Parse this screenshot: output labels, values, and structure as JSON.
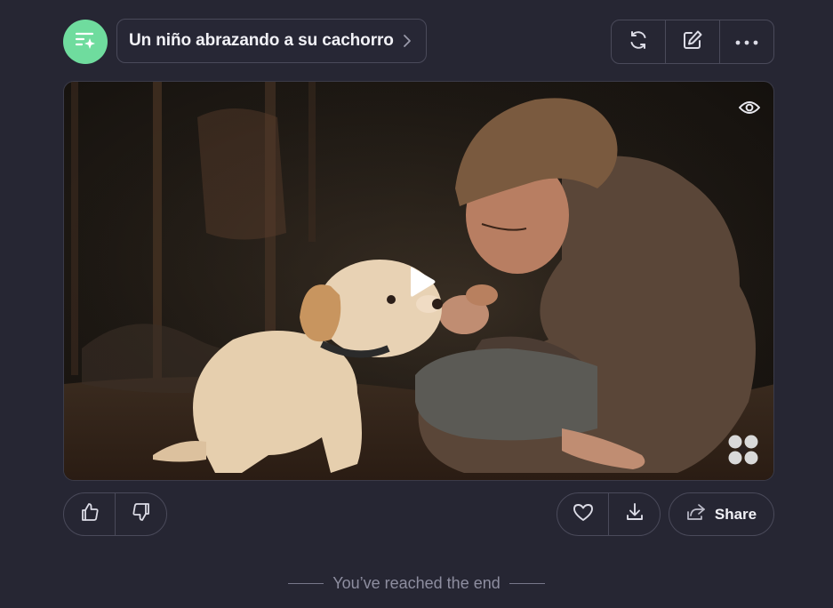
{
  "header": {
    "avatar_icon": "sparkle-list-icon",
    "prompt": "Un niño abrazando a su cachorro",
    "prompt_chevron_icon": "chevron-right-icon",
    "tools": [
      {
        "name": "regenerate-button",
        "icon": "refresh-icon"
      },
      {
        "name": "edit-button",
        "icon": "edit-icon"
      },
      {
        "name": "more-button",
        "icon": "more-horizontal-icon"
      }
    ]
  },
  "media": {
    "view_icon": "eye-icon",
    "play_icon": "play-icon",
    "watermark_icon": "brand-logo-icon"
  },
  "actions": {
    "like_icon": "thumbs-up-icon",
    "dislike_icon": "thumbs-down-icon",
    "favorite_icon": "heart-icon",
    "download_icon": "download-icon",
    "share_icon": "share-icon",
    "share_label": "Share"
  },
  "footer": {
    "end_text": "You’ve reached the end"
  },
  "colors": {
    "background": "#262633",
    "avatar": "#6fdc9e",
    "border": "#4a4a5a",
    "text": "#f1f1f6",
    "muted_text": "#8e8ea0"
  }
}
